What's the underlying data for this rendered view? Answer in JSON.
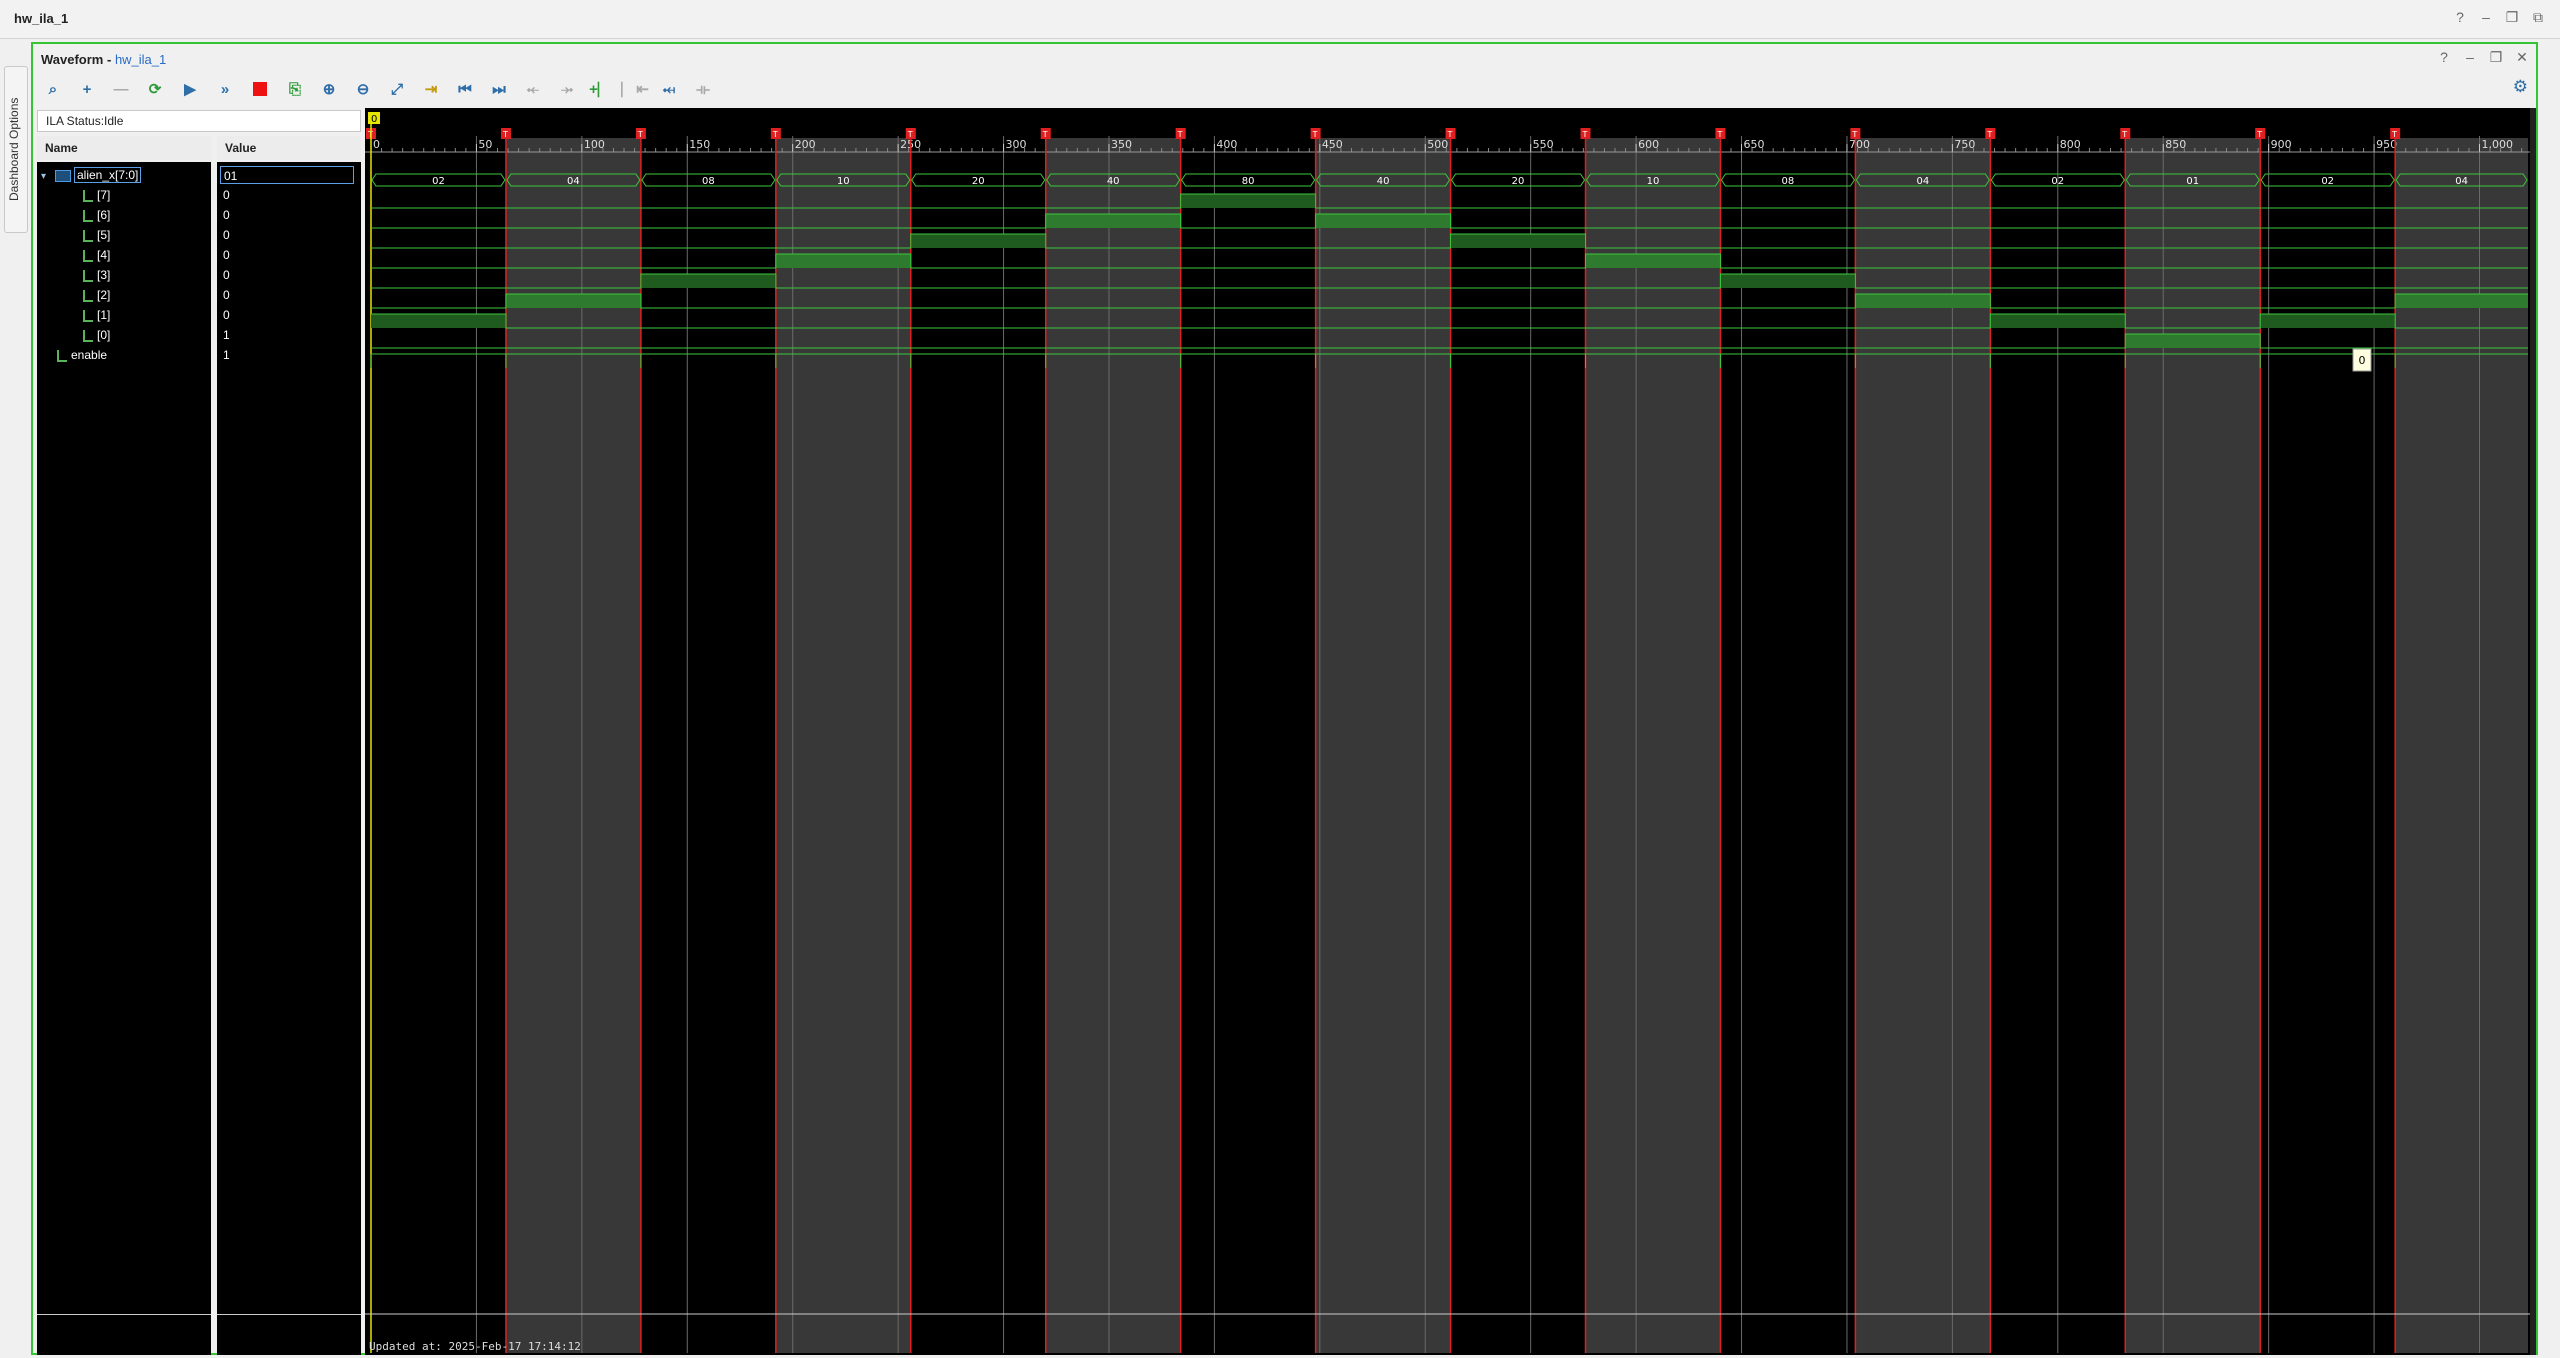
{
  "window": {
    "title": "hw_ila_1"
  },
  "side_tab": {
    "label": "Dashboard Options"
  },
  "waveform": {
    "title": "Waveform",
    "separator": " - ",
    "subtitle": "hw_ila_1",
    "status": "ILA Status:Idle",
    "columns": {
      "name": "Name",
      "value": "Value"
    },
    "signals": [
      {
        "name": "alien_x[7:0]",
        "value": "01",
        "type": "bus"
      },
      {
        "name": "[7]",
        "value": "0",
        "type": "bit"
      },
      {
        "name": "[6]",
        "value": "0",
        "type": "bit"
      },
      {
        "name": "[5]",
        "value": "0",
        "type": "bit"
      },
      {
        "name": "[4]",
        "value": "0",
        "type": "bit"
      },
      {
        "name": "[3]",
        "value": "0",
        "type": "bit"
      },
      {
        "name": "[2]",
        "value": "0",
        "type": "bit"
      },
      {
        "name": "[1]",
        "value": "0",
        "type": "bit"
      },
      {
        "name": "[0]",
        "value": "1",
        "type": "bit"
      },
      {
        "name": "enable",
        "value": "1",
        "type": "bit"
      }
    ],
    "updated": "Updated at: 2025-Feb-17 17:14:12",
    "cursor_label": "0",
    "tooltip_value": "0",
    "trigger_marker": "T",
    "toolbar": [
      "search-icon",
      "add-icon",
      "remove-icon",
      "refresh-icon",
      "run-trigger-icon",
      "run-immediate-icon",
      "stop-icon",
      "export-icon",
      "zoom-in-icon",
      "zoom-out-icon",
      "zoom-fit-icon",
      "go-to-cursor-icon",
      "previous-transition-icon",
      "next-transition-icon",
      "add-marker-icon",
      "previous-marker-icon",
      "next-marker-icon",
      "swap-cursor-icon",
      "snap-icon",
      "full-view-icon"
    ]
  },
  "chart_data": {
    "type": "timing",
    "x_ticks": [
      "0",
      "50",
      "100",
      "150",
      "200",
      "250",
      "300",
      "350",
      "400",
      "450",
      "500",
      "550",
      "600",
      "650",
      "700",
      "750",
      "800",
      "850",
      "900",
      "950",
      "1,000"
    ],
    "xlim": [
      0,
      1023
    ],
    "trigger_positions": [
      0,
      64,
      128,
      192,
      256,
      320,
      384,
      448,
      512,
      576,
      640,
      704,
      768,
      832,
      896,
      960
    ],
    "bus_segments": [
      "02",
      "04",
      "08",
      "10",
      "20",
      "40",
      "80",
      "40",
      "20",
      "10",
      "08",
      "04",
      "02",
      "01",
      "02",
      "04"
    ],
    "colors": {
      "accent": "#3cc83c",
      "trigger": "#e02020",
      "window_border": "#35c435",
      "tooltip_bg": "#fffde0"
    }
  }
}
